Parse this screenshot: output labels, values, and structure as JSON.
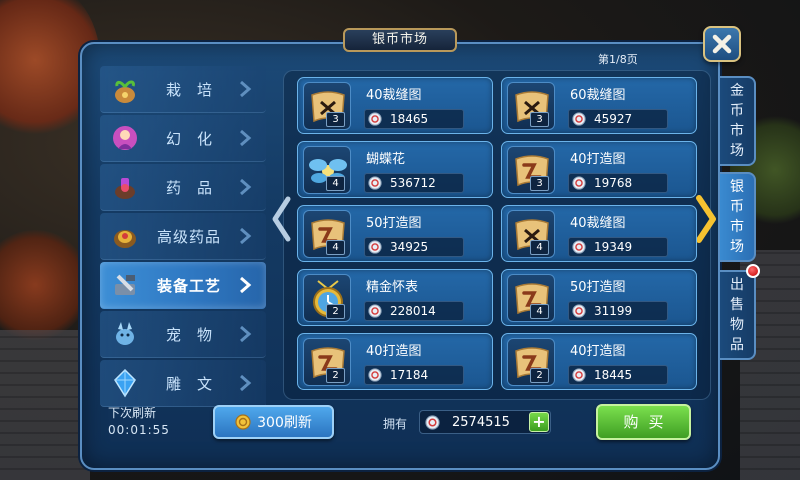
{
  "window": {
    "title": "银币市场",
    "page_indicator": "第1/8页"
  },
  "menu": {
    "items": [
      {
        "label": "栽培",
        "icon": "money-bag-sprout-icon",
        "active": false
      },
      {
        "label": "幻化",
        "icon": "pink-costume-icon",
        "active": false
      },
      {
        "label": "药品",
        "icon": "potion-cauldron-icon",
        "active": false
      },
      {
        "label": "高级药品",
        "icon": "advanced-potion-icon",
        "active": false
      },
      {
        "label": "装备工艺",
        "icon": "crafting-tools-icon",
        "active": true
      },
      {
        "label": "宠物",
        "icon": "pet-icon",
        "active": false
      },
      {
        "label": "雕文",
        "icon": "blue-gem-icon",
        "active": false
      }
    ]
  },
  "refresh": {
    "next_label": "下次刷新",
    "countdown": "00:01:55",
    "button_label": "300刷新"
  },
  "items": [
    {
      "name": "40裁缝图",
      "qty": "3",
      "price": "18465",
      "icon": "scroll-bow-icon"
    },
    {
      "name": "60裁缝图",
      "qty": "3",
      "price": "45927",
      "icon": "scroll-bow-icon"
    },
    {
      "name": "蝴蝶花",
      "qty": "4",
      "price": "536712",
      "icon": "butterfly-flower-icon"
    },
    {
      "name": "40打造图",
      "qty": "3",
      "price": "19768",
      "icon": "scroll-wrench-icon"
    },
    {
      "name": "50打造图",
      "qty": "4",
      "price": "34925",
      "icon": "scroll-wrench-icon"
    },
    {
      "name": "40裁缝图",
      "qty": "4",
      "price": "19349",
      "icon": "scroll-bow-icon"
    },
    {
      "name": "精金怀表",
      "qty": "2",
      "price": "228014",
      "icon": "gold-pocket-watch-icon"
    },
    {
      "name": "50打造图",
      "qty": "4",
      "price": "31199",
      "icon": "scroll-wrench-icon"
    },
    {
      "name": "40打造图",
      "qty": "2",
      "price": "17184",
      "icon": "scroll-wrench-icon"
    },
    {
      "name": "40打造图",
      "qty": "2",
      "price": "18445",
      "icon": "scroll-wrench-icon"
    }
  ],
  "footer": {
    "owned_label": "拥有",
    "owned_value": "2574515",
    "plus_label": "+",
    "buy_label": "购买"
  },
  "tabs": [
    {
      "label": "金币市场",
      "active": false
    },
    {
      "label": "银币市场",
      "active": true
    },
    {
      "label": "出售物品",
      "active": false,
      "notification": true
    }
  ],
  "colors": {
    "panel_blue": "#143a63",
    "card_blue": "#2468a8",
    "active_menu": "#3d8fd6",
    "buy_green": "#5fc23a",
    "notification_red": "#d41111"
  }
}
